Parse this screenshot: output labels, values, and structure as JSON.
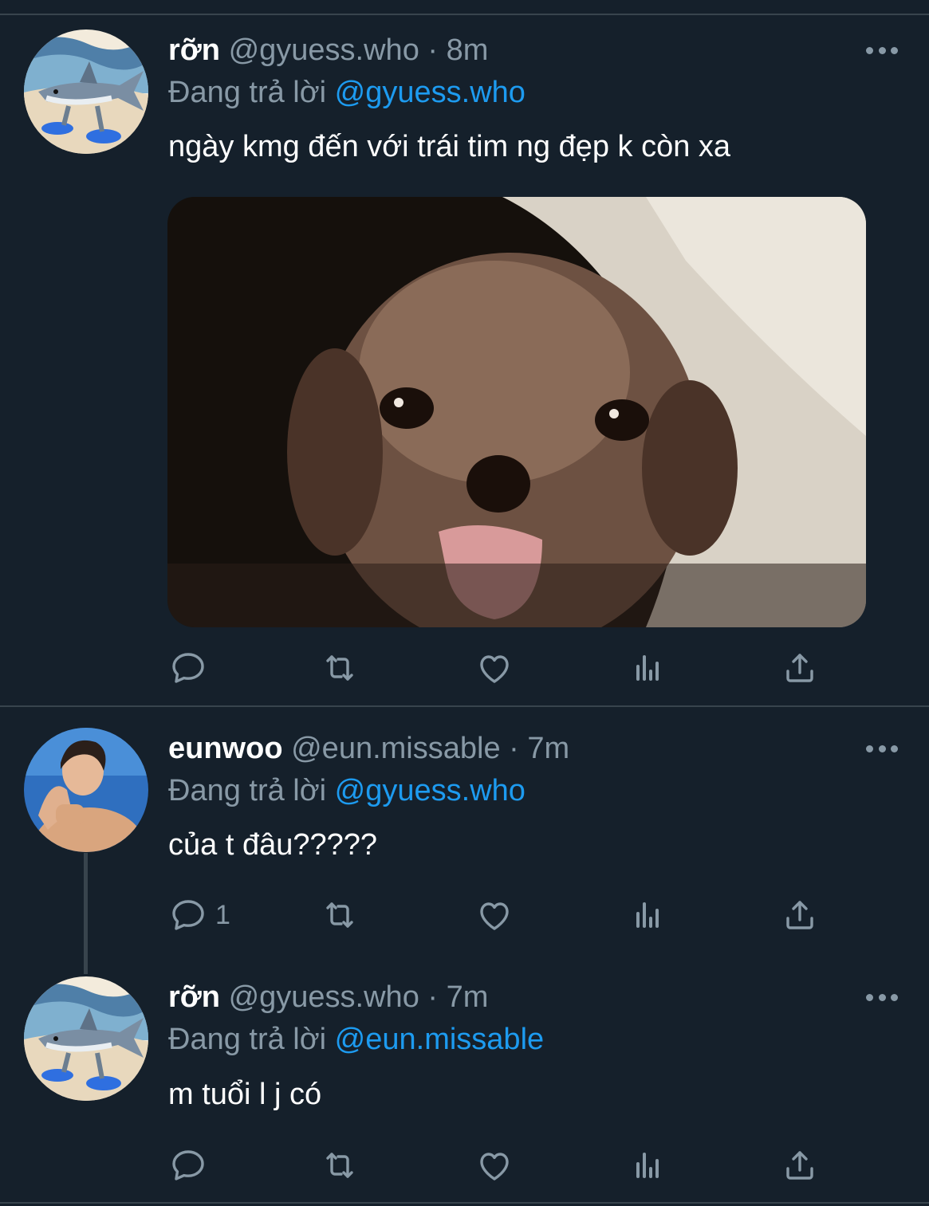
{
  "tweets": [
    {
      "name": "rỡn",
      "handle": "@gyuess.who",
      "time": "· 8m",
      "reply_prefix": "Đang trả lời",
      "reply_to": "@gyuess.who",
      "text": "ngày kmg đến với trái tim ng đẹp k còn xa",
      "reply_count": "",
      "avatar": "shark-avatar",
      "has_media": true,
      "media": "puppy-photo"
    },
    {
      "name": "eunwoo",
      "handle": "@eun.missable",
      "time": "· 7m",
      "reply_prefix": "Đang trả lời",
      "reply_to": "@gyuess.who",
      "text": "của t đâu?????",
      "reply_count": "1",
      "avatar": "person-avatar"
    },
    {
      "name": "rỡn",
      "handle": "@gyuess.who",
      "time": "· 7m",
      "reply_prefix": "Đang trả lời",
      "reply_to": "@eun.missable",
      "text": "m tuổi l j có",
      "reply_count": "",
      "avatar": "shark-avatar"
    }
  ],
  "actions": [
    "reply-icon",
    "retweet-icon",
    "like-icon",
    "analytics-icon",
    "share-icon"
  ],
  "colors": {
    "background": "#15202b",
    "secondary_text": "#8899a6",
    "accent": "#1d9bf0",
    "divider": "#38444d"
  }
}
